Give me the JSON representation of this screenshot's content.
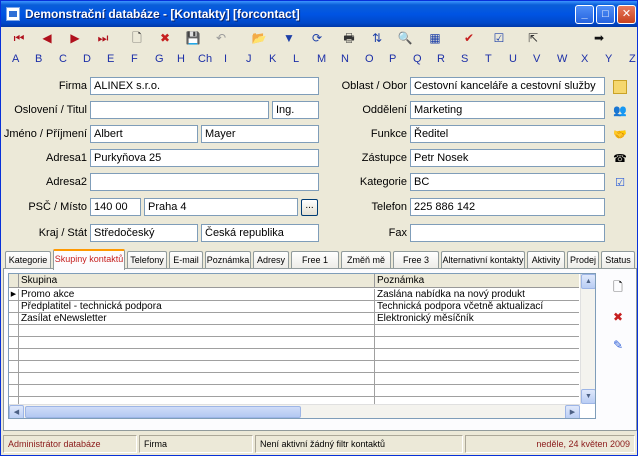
{
  "window": {
    "title": "Demonstrační databáze - [Kontakty] [forcontact]",
    "controls": {
      "minimize": "_",
      "maximize": "□",
      "close": "✕"
    }
  },
  "toolbar": {
    "icons": [
      "first-record-icon",
      "prev-record-icon",
      "next-record-icon",
      "last-record-icon",
      "new-record-icon",
      "delete-record-icon",
      "save-icon",
      "undo-icon",
      "open-folder-icon",
      "filter-icon",
      "refresh-icon",
      "print-icon",
      "sort-icon",
      "find-icon",
      "table-view-icon",
      "check-icon",
      "edit-check-icon",
      "export-icon",
      "arrow-right-icon"
    ],
    "glyphs": [
      "⏮",
      "◀",
      "▶",
      "⏭",
      "🗋",
      "✖",
      "💾",
      "↶",
      "📂",
      "▼",
      "⟳",
      "🖶",
      "⇅",
      "🔍",
      "▦",
      "✔",
      "☑",
      "⇱",
      "➡"
    ]
  },
  "alphabet": [
    "A",
    "B",
    "C",
    "D",
    "E",
    "F",
    "G",
    "H",
    "Ch",
    "I",
    "J",
    "K",
    "L",
    "M",
    "N",
    "O",
    "P",
    "Q",
    "R",
    "S",
    "T",
    "U",
    "V",
    "W",
    "X",
    "Y",
    "Z"
  ],
  "form": {
    "firma": {
      "label": "Firma",
      "value": "ALINEX s.r.o."
    },
    "osloveni": {
      "label": "Oslovení / Titul",
      "value": "",
      "titul": "Ing."
    },
    "jmeno": {
      "label": "Jméno / Příjmení",
      "jmeno": "Albert",
      "prijmeni": "Mayer"
    },
    "adresa1": {
      "label": "Adresa1",
      "value": "Purkyňova 25"
    },
    "adresa2": {
      "label": "Adresa2",
      "value": ""
    },
    "psc": {
      "label": "PSČ / Místo",
      "psc": "140 00",
      "misto": "Praha 4",
      "button": "..."
    },
    "kraj": {
      "label": "Kraj / Stát",
      "kraj": "Středočeský",
      "stat": "Česká republika"
    },
    "oblast": {
      "label": "Oblast / Obor",
      "value": "Cestovní kanceláře a cestovní služby"
    },
    "oddeleni": {
      "label": "Oddělení",
      "value": "Marketing"
    },
    "funkce": {
      "label": "Funkce",
      "value": "Ředitel"
    },
    "zastupce": {
      "label": "Zástupce",
      "value": "Petr Nosek"
    },
    "kategorie": {
      "label": "Kategorie",
      "value": "BC"
    },
    "telefon": {
      "label": "Telefon",
      "value": "225 886 142"
    },
    "fax": {
      "label": "Fax",
      "value": ""
    }
  },
  "tabs": [
    {
      "label": "Kategorie",
      "active": false
    },
    {
      "label": "Skupiny kontaktů",
      "active": true
    },
    {
      "label": "Telefony",
      "active": false
    },
    {
      "label": "E-mail",
      "active": false
    },
    {
      "label": "Poznámka",
      "active": false
    },
    {
      "label": "Adresy",
      "active": false
    },
    {
      "label": "Free 1",
      "active": false
    },
    {
      "label": "Změň mě",
      "active": false
    },
    {
      "label": "Free 3",
      "active": false
    },
    {
      "label": "Alternativní kontakty",
      "active": false
    },
    {
      "label": "Aktivity",
      "active": false
    },
    {
      "label": "Prodej",
      "active": false
    },
    {
      "label": "Status",
      "active": false
    }
  ],
  "grid": {
    "columns": [
      "Skupina",
      "Poznámka"
    ],
    "rows": [
      {
        "skupina": "Promo akce",
        "poznamka": "Zaslána nabídka na nový produkt",
        "current": true
      },
      {
        "skupina": "Předplatitel - technická podpora",
        "poznamka": "Technická podpora včetně aktualizací",
        "current": false
      },
      {
        "skupina": "Zasílat eNewsletter",
        "poznamka": "Elektronický měsíčník",
        "current": false
      }
    ],
    "indicator": "▶"
  },
  "status": {
    "user": "Administrátor databáze",
    "form": "Firma",
    "filter": "Není aktivní žádný filtr kontaktů",
    "date": "neděle, 24 květen 2009"
  },
  "colors": {
    "title_blue": "#0054e3",
    "alpha_link": "#1c2fa8",
    "active_tab_text": "#c62020",
    "status_text": "#8b1a1a"
  }
}
